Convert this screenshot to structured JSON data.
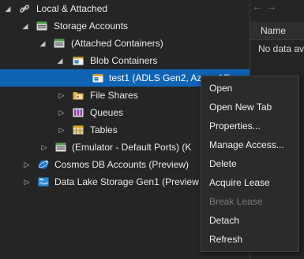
{
  "tree": [
    {
      "label": "Local & Attached",
      "icon": "link-icon",
      "arrow": "expanded"
    },
    {
      "label": "Storage Accounts",
      "icon": "storage-account-icon",
      "arrow": "expanded"
    },
    {
      "label": "(Attached Containers)",
      "icon": "storage-account-icon",
      "arrow": "expanded"
    },
    {
      "label": "Blob Containers",
      "icon": "blob-container-icon",
      "arrow": "expanded"
    },
    {
      "label": "test1 (ADLS Gen2, Azure AD",
      "icon": "blob-container-icon",
      "arrow": "none",
      "selected": true
    },
    {
      "label": "File Shares",
      "icon": "file-share-icon",
      "arrow": "collapsed"
    },
    {
      "label": "Queues",
      "icon": "queue-icon",
      "arrow": "collapsed"
    },
    {
      "label": "Tables",
      "icon": "table-icon",
      "arrow": "collapsed"
    },
    {
      "label": "(Emulator - Default Ports) (K",
      "icon": "storage-account-icon",
      "arrow": "collapsed"
    },
    {
      "label": "Cosmos DB Accounts (Preview)",
      "icon": "cosmos-db-icon",
      "arrow": "collapsed"
    },
    {
      "label": "Data Lake Storage Gen1 (Preview",
      "icon": "data-lake-icon",
      "arrow": "collapsed"
    }
  ],
  "right_panel": {
    "nav_glyphs": "← →",
    "column_header": "Name",
    "empty_text": "No data av"
  },
  "context_menu": [
    {
      "label": "Open",
      "enabled": true
    },
    {
      "label": "Open New Tab",
      "enabled": true
    },
    {
      "label": "Properties...",
      "enabled": true
    },
    {
      "label": "Manage Access...",
      "enabled": true
    },
    {
      "label": "Delete",
      "enabled": true
    },
    {
      "label": "Acquire Lease",
      "enabled": true
    },
    {
      "label": "Break Lease",
      "enabled": false
    },
    {
      "label": "Detach",
      "enabled": true
    },
    {
      "label": "Refresh",
      "enabled": true
    }
  ],
  "colors": {
    "background": "#252526",
    "selection": "#0e63b5",
    "menu_background": "#2b2b2b",
    "disabled_text": "#7a7a7a"
  }
}
